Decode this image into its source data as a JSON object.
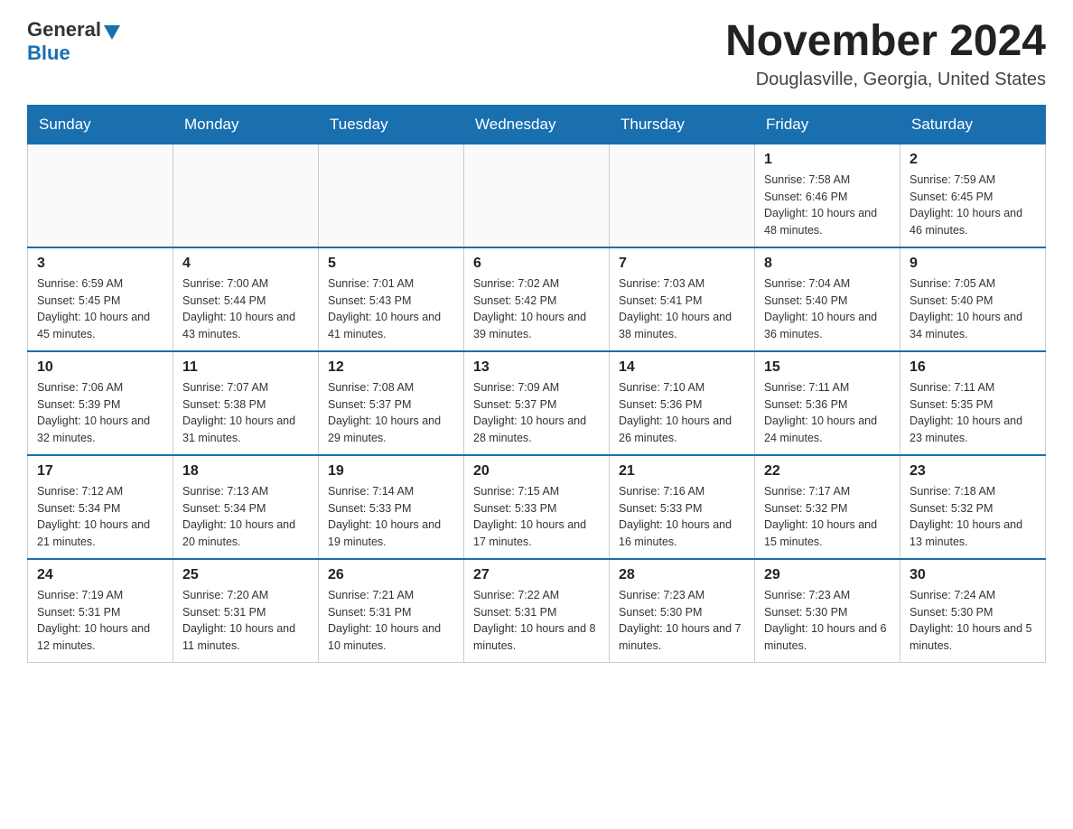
{
  "header": {
    "logo_general": "General",
    "logo_blue": "Blue",
    "month_title": "November 2024",
    "location": "Douglasville, Georgia, United States"
  },
  "days_of_week": [
    "Sunday",
    "Monday",
    "Tuesday",
    "Wednesday",
    "Thursday",
    "Friday",
    "Saturday"
  ],
  "weeks": [
    [
      {
        "day": "",
        "info": ""
      },
      {
        "day": "",
        "info": ""
      },
      {
        "day": "",
        "info": ""
      },
      {
        "day": "",
        "info": ""
      },
      {
        "day": "",
        "info": ""
      },
      {
        "day": "1",
        "info": "Sunrise: 7:58 AM\nSunset: 6:46 PM\nDaylight: 10 hours and 48 minutes."
      },
      {
        "day": "2",
        "info": "Sunrise: 7:59 AM\nSunset: 6:45 PM\nDaylight: 10 hours and 46 minutes."
      }
    ],
    [
      {
        "day": "3",
        "info": "Sunrise: 6:59 AM\nSunset: 5:45 PM\nDaylight: 10 hours and 45 minutes."
      },
      {
        "day": "4",
        "info": "Sunrise: 7:00 AM\nSunset: 5:44 PM\nDaylight: 10 hours and 43 minutes."
      },
      {
        "day": "5",
        "info": "Sunrise: 7:01 AM\nSunset: 5:43 PM\nDaylight: 10 hours and 41 minutes."
      },
      {
        "day": "6",
        "info": "Sunrise: 7:02 AM\nSunset: 5:42 PM\nDaylight: 10 hours and 39 minutes."
      },
      {
        "day": "7",
        "info": "Sunrise: 7:03 AM\nSunset: 5:41 PM\nDaylight: 10 hours and 38 minutes."
      },
      {
        "day": "8",
        "info": "Sunrise: 7:04 AM\nSunset: 5:40 PM\nDaylight: 10 hours and 36 minutes."
      },
      {
        "day": "9",
        "info": "Sunrise: 7:05 AM\nSunset: 5:40 PM\nDaylight: 10 hours and 34 minutes."
      }
    ],
    [
      {
        "day": "10",
        "info": "Sunrise: 7:06 AM\nSunset: 5:39 PM\nDaylight: 10 hours and 32 minutes."
      },
      {
        "day": "11",
        "info": "Sunrise: 7:07 AM\nSunset: 5:38 PM\nDaylight: 10 hours and 31 minutes."
      },
      {
        "day": "12",
        "info": "Sunrise: 7:08 AM\nSunset: 5:37 PM\nDaylight: 10 hours and 29 minutes."
      },
      {
        "day": "13",
        "info": "Sunrise: 7:09 AM\nSunset: 5:37 PM\nDaylight: 10 hours and 28 minutes."
      },
      {
        "day": "14",
        "info": "Sunrise: 7:10 AM\nSunset: 5:36 PM\nDaylight: 10 hours and 26 minutes."
      },
      {
        "day": "15",
        "info": "Sunrise: 7:11 AM\nSunset: 5:36 PM\nDaylight: 10 hours and 24 minutes."
      },
      {
        "day": "16",
        "info": "Sunrise: 7:11 AM\nSunset: 5:35 PM\nDaylight: 10 hours and 23 minutes."
      }
    ],
    [
      {
        "day": "17",
        "info": "Sunrise: 7:12 AM\nSunset: 5:34 PM\nDaylight: 10 hours and 21 minutes."
      },
      {
        "day": "18",
        "info": "Sunrise: 7:13 AM\nSunset: 5:34 PM\nDaylight: 10 hours and 20 minutes."
      },
      {
        "day": "19",
        "info": "Sunrise: 7:14 AM\nSunset: 5:33 PM\nDaylight: 10 hours and 19 minutes."
      },
      {
        "day": "20",
        "info": "Sunrise: 7:15 AM\nSunset: 5:33 PM\nDaylight: 10 hours and 17 minutes."
      },
      {
        "day": "21",
        "info": "Sunrise: 7:16 AM\nSunset: 5:33 PM\nDaylight: 10 hours and 16 minutes."
      },
      {
        "day": "22",
        "info": "Sunrise: 7:17 AM\nSunset: 5:32 PM\nDaylight: 10 hours and 15 minutes."
      },
      {
        "day": "23",
        "info": "Sunrise: 7:18 AM\nSunset: 5:32 PM\nDaylight: 10 hours and 13 minutes."
      }
    ],
    [
      {
        "day": "24",
        "info": "Sunrise: 7:19 AM\nSunset: 5:31 PM\nDaylight: 10 hours and 12 minutes."
      },
      {
        "day": "25",
        "info": "Sunrise: 7:20 AM\nSunset: 5:31 PM\nDaylight: 10 hours and 11 minutes."
      },
      {
        "day": "26",
        "info": "Sunrise: 7:21 AM\nSunset: 5:31 PM\nDaylight: 10 hours and 10 minutes."
      },
      {
        "day": "27",
        "info": "Sunrise: 7:22 AM\nSunset: 5:31 PM\nDaylight: 10 hours and 8 minutes."
      },
      {
        "day": "28",
        "info": "Sunrise: 7:23 AM\nSunset: 5:30 PM\nDaylight: 10 hours and 7 minutes."
      },
      {
        "day": "29",
        "info": "Sunrise: 7:23 AM\nSunset: 5:30 PM\nDaylight: 10 hours and 6 minutes."
      },
      {
        "day": "30",
        "info": "Sunrise: 7:24 AM\nSunset: 5:30 PM\nDaylight: 10 hours and 5 minutes."
      }
    ]
  ],
  "colors": {
    "header_bg": "#1a6faf",
    "header_text": "#ffffff",
    "border": "#1a6faf",
    "cell_border": "#cccccc"
  }
}
